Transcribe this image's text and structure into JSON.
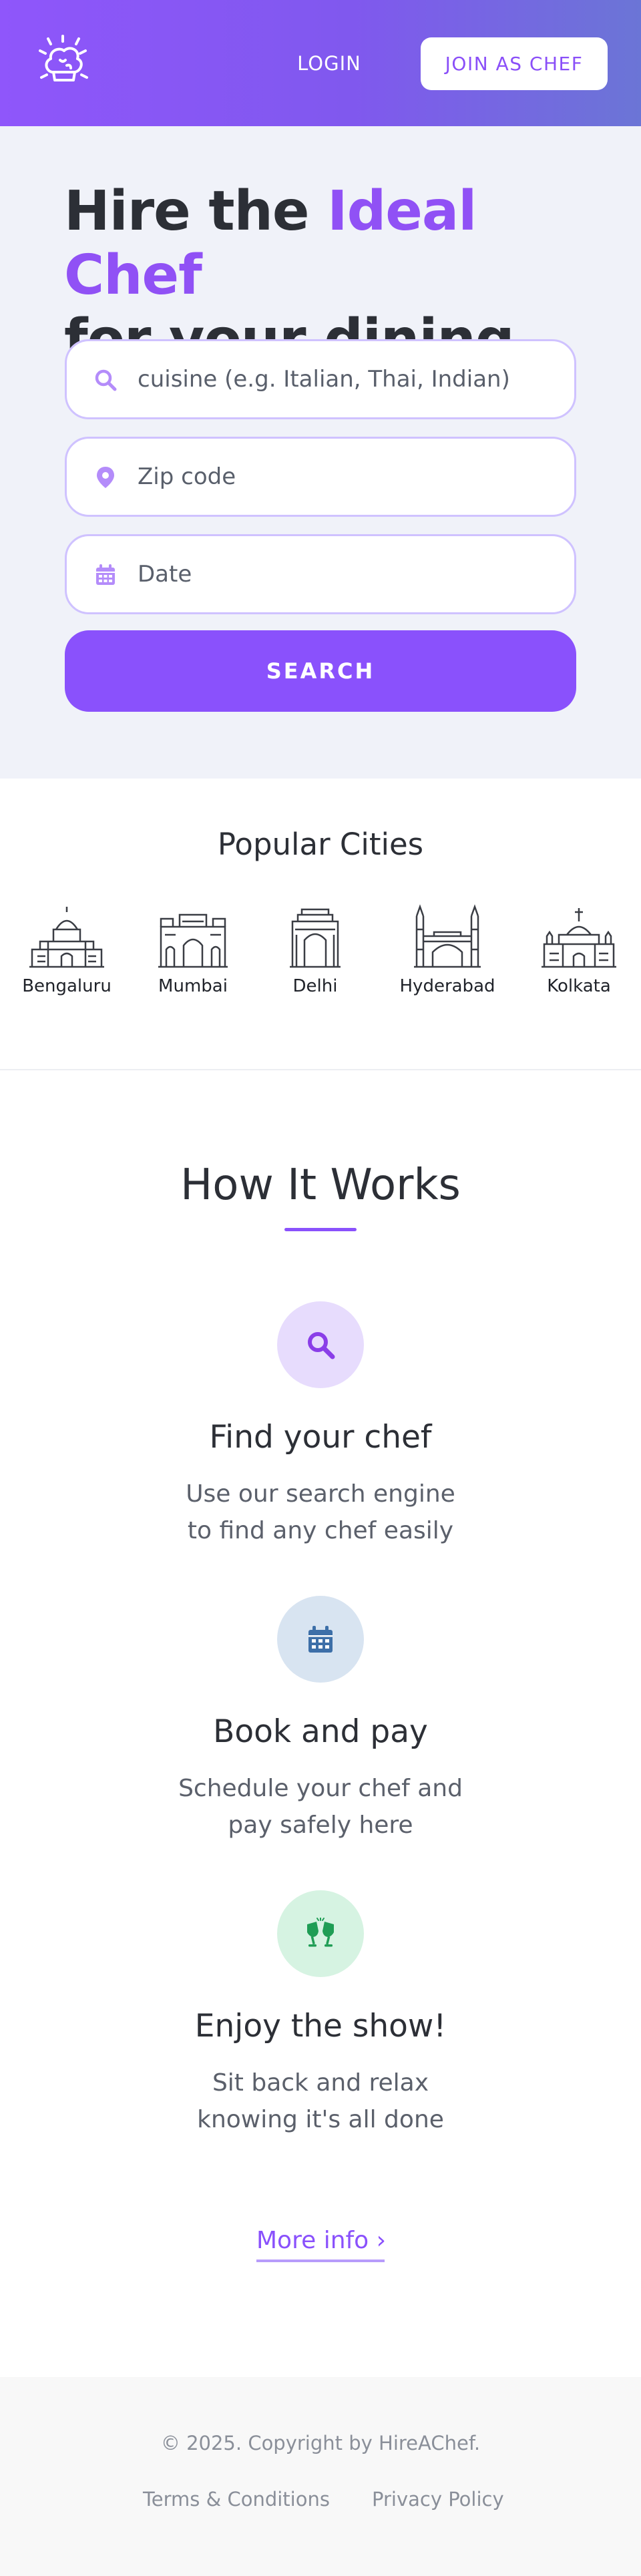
{
  "header": {
    "login_label": "LOGIN",
    "join_label": "JOIN AS CHEF",
    "logo_icon": "chef-hat-logo-icon",
    "colors": {
      "gradient_start": "#8f56fb",
      "gradient_end": "#6b75d6"
    }
  },
  "hero": {
    "title_part1": "Hire the ",
    "title_accent": "Ideal Chef",
    "title_part2": "for your dining",
    "fields": [
      {
        "icon": "search-icon",
        "placeholder": "cuisine (e.g. Italian, Thai, Indian)"
      },
      {
        "icon": "location-pin-icon",
        "placeholder": "Zip code"
      },
      {
        "icon": "calendar-icon",
        "placeholder": "Date"
      }
    ],
    "search_label": "SEARCH",
    "colors": {
      "accent": "#9051f5",
      "button": "#8a51fc"
    }
  },
  "cities": {
    "title": "Popular Cities",
    "items": [
      {
        "name": "Bengaluru",
        "icon": "bengaluru-landmark-icon"
      },
      {
        "name": "Mumbai",
        "icon": "mumbai-gateway-icon"
      },
      {
        "name": "Delhi",
        "icon": "delhi-india-gate-icon"
      },
      {
        "name": "Hyderabad",
        "icon": "hyderabad-charminar-icon"
      },
      {
        "name": "Kolkata",
        "icon": "kolkata-victoria-memorial-icon"
      }
    ]
  },
  "how": {
    "title": "How It Works",
    "steps": [
      {
        "icon": "search-icon",
        "title": "Find your chef",
        "desc_line1": "Use our search engine",
        "desc_line2": "to find any chef easily",
        "color": "#e7dcfd"
      },
      {
        "icon": "calendar-icon",
        "title": "Book and pay",
        "desc_line1": "Schedule your chef and",
        "desc_line2": "pay safely here",
        "color": "#d8e4f1"
      },
      {
        "icon": "glasses-cheers-icon",
        "title": "Enjoy the show!",
        "desc_line1": "Sit back and relax",
        "desc_line2": "knowing it's all done",
        "color": "#d6f3e2"
      }
    ],
    "more_info": "More info ›"
  },
  "footer": {
    "copyright": "© 2025. Copyright by HireAChef.",
    "terms": "Terms & Conditions",
    "privacy": "Privacy Policy"
  }
}
